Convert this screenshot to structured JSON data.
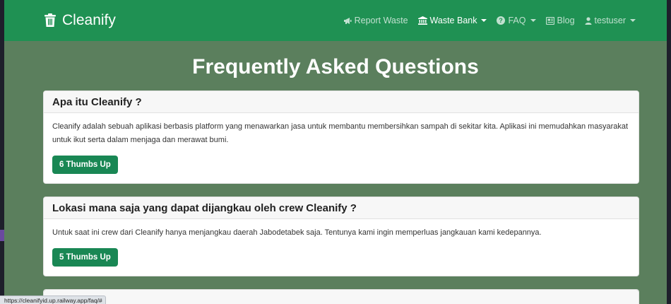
{
  "navbar": {
    "brand": "Cleanify",
    "items": [
      {
        "label": "Report Waste",
        "icon": "megaphone-icon",
        "dropdown": false,
        "active": false
      },
      {
        "label": "Waste Bank",
        "icon": "bank-icon",
        "dropdown": true,
        "active": true
      },
      {
        "label": "FAQ",
        "icon": "question-circle-icon",
        "dropdown": true,
        "active": false
      },
      {
        "label": "Blog",
        "icon": "newspaper-icon",
        "dropdown": false,
        "active": false
      },
      {
        "label": "testuser",
        "icon": "person-icon",
        "dropdown": true,
        "active": false
      }
    ]
  },
  "page": {
    "title": "Frequently Asked Questions"
  },
  "faqs": [
    {
      "question": "Apa itu Cleanify ?",
      "answer": "Cleanify adalah sebuah aplikasi berbasis platform yang menawarkan jasa untuk membantu membersihkan sampah di sekitar kita. Aplikasi ini memudahkan masyarakat untuk ikut serta dalam menjaga dan merawat bumi.",
      "thumbs": "6 Thumbs Up"
    },
    {
      "question": "Lokasi mana saja yang dapat dijangkau oleh crew Cleanify ?",
      "answer": "Untuk saat ini crew dari Cleanify hanya menjangkau daerah Jabodetabek saja. Tentunya kami ingin memperluas jangkauan kami kedepannya.",
      "thumbs": "5 Thumbs Up"
    }
  ],
  "status_bar": {
    "url": "https://cleanifyid.up.railway.app/faq/#"
  },
  "colors": {
    "navbar": "#1f9153",
    "background": "#5b7f5d",
    "button": "#198754"
  }
}
